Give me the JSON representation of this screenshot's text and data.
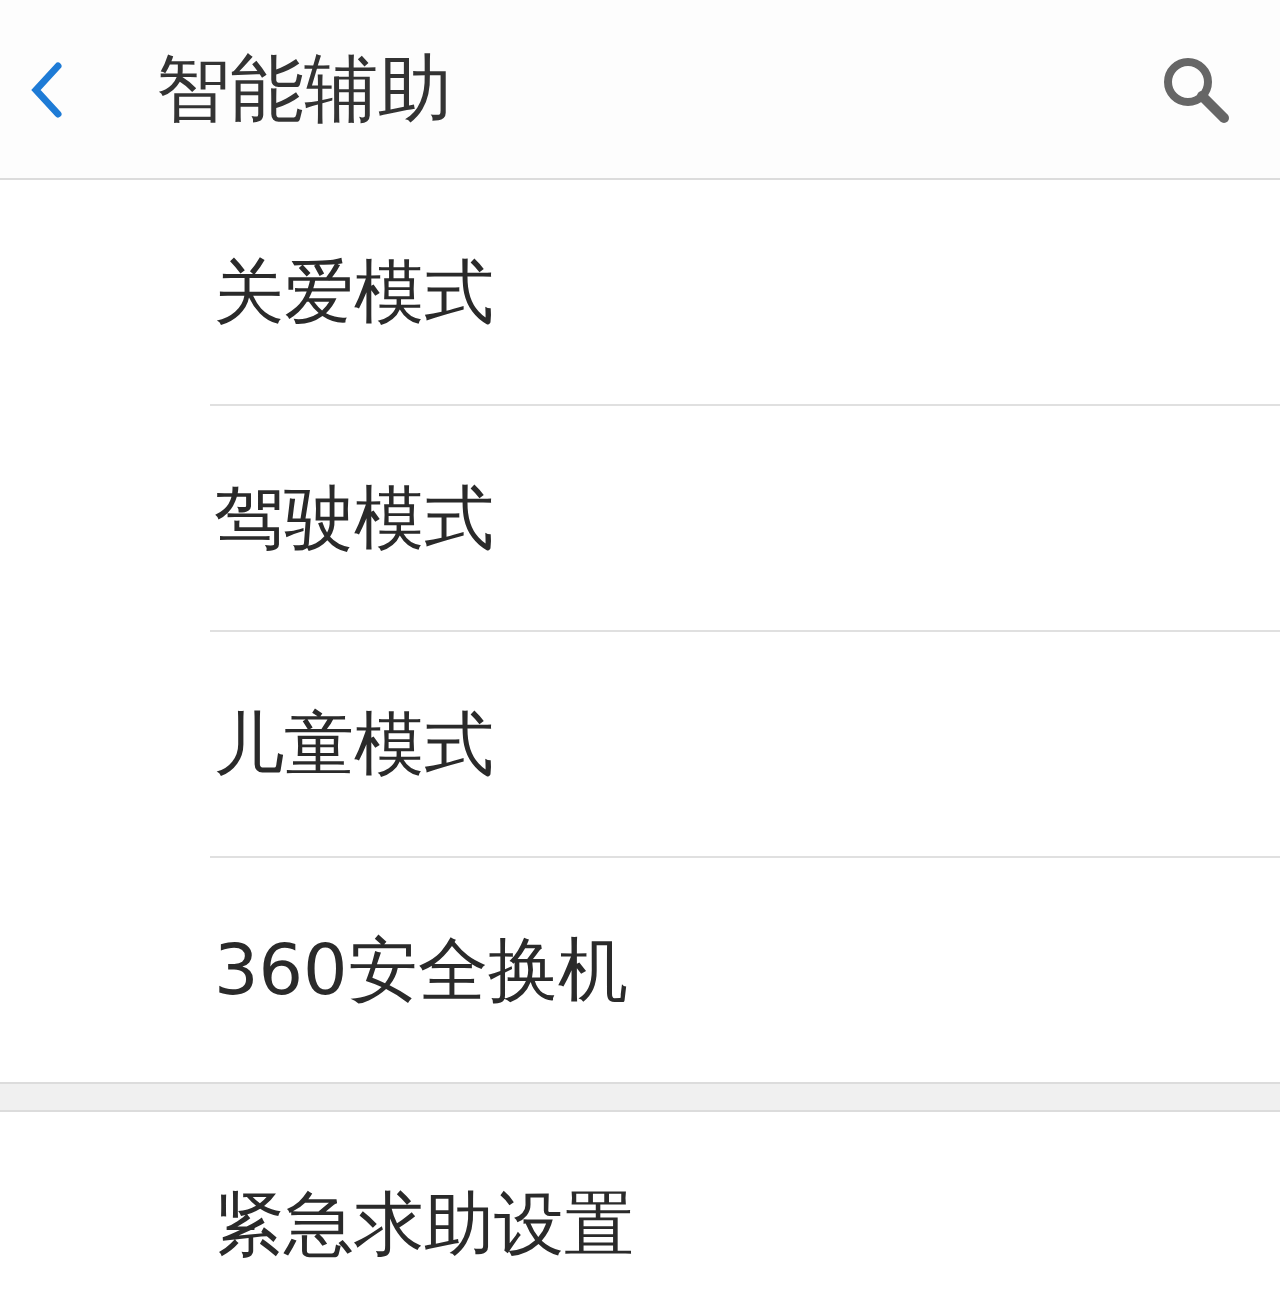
{
  "header": {
    "title": "智能辅助"
  },
  "groups": [
    {
      "items": [
        {
          "label": "关爱模式"
        },
        {
          "label": "驾驶模式"
        },
        {
          "label": "儿童模式"
        },
        {
          "label": "360安全换机"
        }
      ]
    },
    {
      "items": [
        {
          "label": "紧急求助设置"
        }
      ]
    }
  ]
}
